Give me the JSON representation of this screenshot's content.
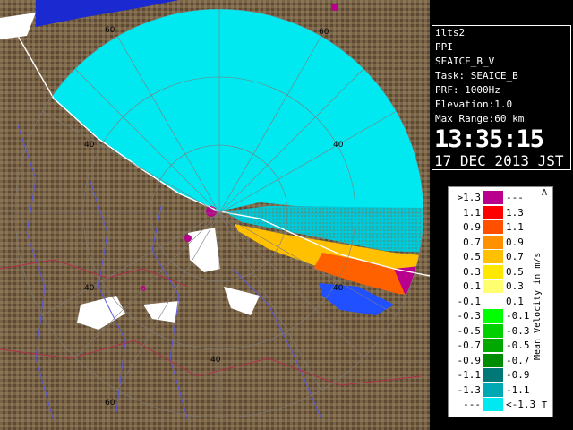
{
  "info": {
    "site": "ilts2",
    "product": "PPI",
    "data_type": "SEAICE_B_V",
    "task": "Task: SEAICE_B",
    "prf": "PRF: 1000Hz",
    "elevation": "Elevation:1.0",
    "max_range": "Max Range:60 km",
    "time": "13:35:15",
    "date": "17 DEC 2013 JST"
  },
  "range_labels": [
    "60",
    "60",
    "40",
    "40",
    "40",
    "40",
    "40",
    "60"
  ],
  "legend": {
    "title": "Mean Velocity in m/s",
    "corner_top": "A",
    "corner_bottom": "T",
    "rows": [
      {
        "left": ">1.3",
        "right": "---",
        "color": "#b8008c"
      },
      {
        "left": "1.1",
        "right": "1.3",
        "color": "#ff0000"
      },
      {
        "left": "0.9",
        "right": "1.1",
        "color": "#ff5000"
      },
      {
        "left": "0.7",
        "right": "0.9",
        "color": "#ff9000"
      },
      {
        "left": "0.5",
        "right": "0.7",
        "color": "#ffc000"
      },
      {
        "left": "0.3",
        "right": "0.5",
        "color": "#ffe800"
      },
      {
        "left": "0.1",
        "right": "0.3",
        "color": "#ffff70"
      },
      {
        "left": "-0.1",
        "right": "0.1",
        "color": "#ffffff"
      },
      {
        "left": "-0.3",
        "right": "-0.1",
        "color": "#00ff00"
      },
      {
        "left": "-0.5",
        "right": "-0.3",
        "color": "#00d000"
      },
      {
        "left": "-0.7",
        "right": "-0.5",
        "color": "#00a800"
      },
      {
        "left": "-0.9",
        "right": "-0.7",
        "color": "#008c00"
      },
      {
        "left": "-1.1",
        "right": "-0.9",
        "color": "#007878"
      },
      {
        "left": "-1.3",
        "right": "-1.1",
        "color": "#00a8b4"
      },
      {
        "left": "---",
        "right": "<-1.3",
        "color": "#00e8f0"
      }
    ]
  },
  "colors": {
    "land": "#7a6448",
    "sea": "#00e8f0",
    "background": "#000000"
  }
}
